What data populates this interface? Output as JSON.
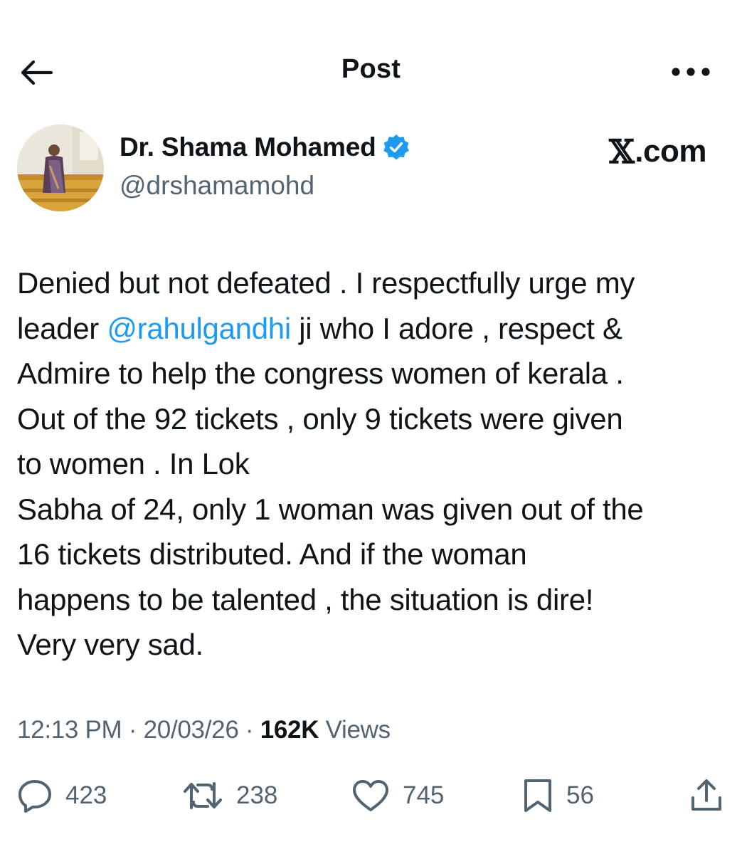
{
  "header": {
    "title": "Post",
    "back_icon": "arrow-left-icon",
    "more_icon": "more-horizontal-icon"
  },
  "author": {
    "name": "Dr. Shama Mohamed",
    "handle": "@drshamamohd",
    "verified_icon": "verified-badge-icon",
    "verified_color": "#1d9bf0"
  },
  "watermark": {
    "text": ".com",
    "logo_glyph": "𝕏"
  },
  "tweet": {
    "lines": [
      {
        "text": "Denied but not defeated . I respectfully urge my"
      },
      {
        "pre": "leader ",
        "mention": "@rahulgandhi",
        "post": " ji who I adore , respect &"
      },
      {
        "text": "Admire to help the congress women of kerala ."
      },
      {
        "text": "Out of the 92 tickets , only 9 tickets were given"
      },
      {
        "text": "to women . In Lok"
      },
      {
        "text": "Sabha of 24, only 1 woman was given out of the"
      },
      {
        "text": "16 tickets distributed. And if the woman"
      },
      {
        "text": "happens to be talented , the situation is dire!"
      },
      {
        "text": "Very very sad."
      }
    ],
    "mention_color": "#1d9bf0"
  },
  "meta": {
    "time": "12:13 PM",
    "separator": " · ",
    "date": "20/03/26",
    "views_count": "162K",
    "views_label": " Views"
  },
  "actions": {
    "replies": {
      "icon": "reply-icon",
      "count": "423"
    },
    "reposts": {
      "icon": "repost-icon",
      "count": "238"
    },
    "likes": {
      "icon": "heart-icon",
      "count": "745"
    },
    "bookmarks": {
      "icon": "bookmark-icon",
      "count": "56"
    },
    "share": {
      "icon": "share-icon"
    }
  },
  "colors": {
    "text": "#0f1419",
    "secondary": "#536471",
    "accent": "#1d9bf0"
  }
}
